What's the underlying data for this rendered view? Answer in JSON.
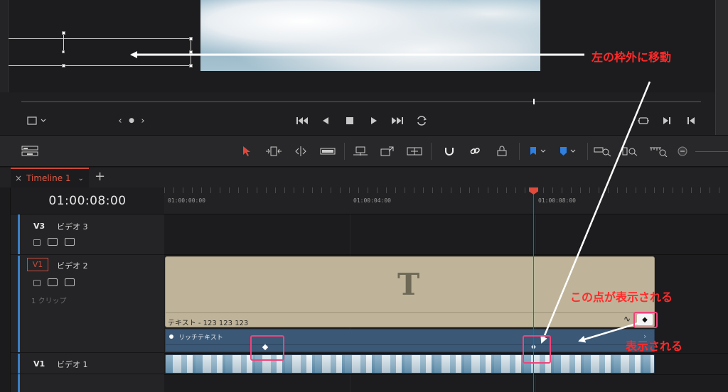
{
  "viewer": {
    "nav_prev": "‹",
    "nav_dot": "●",
    "nav_next": "›"
  },
  "timeline": {
    "tab_label": "Timeline 1",
    "tab_close": "×",
    "tab_add": "+",
    "timecode": "01:00:08:00",
    "ruler": [
      "01:00:00:00",
      "01:00:04:00",
      "01:00:08:00"
    ]
  },
  "tracks": {
    "v3": {
      "id": "V3",
      "name": "ビデオ 3"
    },
    "v2": {
      "id": "V1",
      "name": "ビデオ 2",
      "clip_count": "1 クリップ"
    },
    "v1": {
      "id": "V1",
      "name": "ビデオ 1"
    }
  },
  "clips": {
    "title_letter": "T",
    "title_name": "テキスト - 123  123  123",
    "keyframe_lane": "リッチテキスト",
    "keyframe_button": "◆"
  },
  "annotations": {
    "move_out": "左の枠外に移動",
    "point_shown": "この点が表示される",
    "shown": "表示される",
    "color": "#ff2a2a",
    "box_color": "#f0447a"
  },
  "colors": {
    "playhead": "#e04a3a",
    "title_clip": "#bfb49a",
    "keyframe_lane": "#3b5876"
  }
}
